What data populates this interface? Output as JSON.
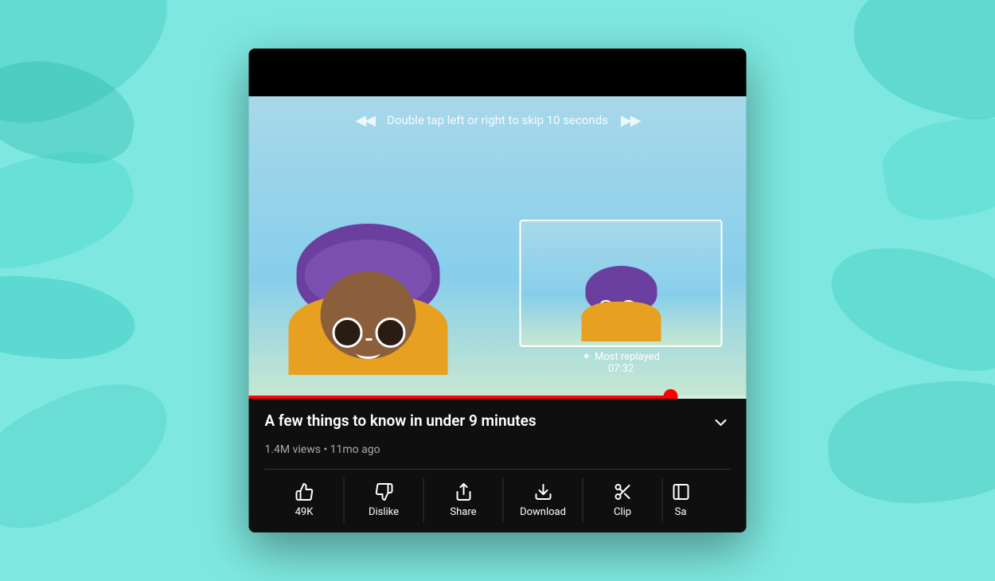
{
  "background": {
    "color": "#7ee8e0"
  },
  "device": {
    "top_bar_height": 60
  },
  "video": {
    "skip_hint": "Double tap left or right to skip 10 seconds",
    "most_replayed_label": "✦ Most replayed",
    "most_replayed_time": "07:32",
    "progress_percent": 85,
    "title": "A few things to know in under 9 minutes",
    "views": "1.4M views",
    "age": "11mo ago",
    "meta": "1.4M views • 11mo ago"
  },
  "actions": [
    {
      "id": "like",
      "label": "49K",
      "icon": "thumbs-up"
    },
    {
      "id": "dislike",
      "label": "Dislike",
      "icon": "thumbs-down"
    },
    {
      "id": "share",
      "label": "Share",
      "icon": "share"
    },
    {
      "id": "download",
      "label": "Download",
      "icon": "download"
    },
    {
      "id": "clip",
      "label": "Clip",
      "icon": "scissors"
    },
    {
      "id": "save",
      "label": "Sa...",
      "icon": "save"
    }
  ],
  "chevron": "∨"
}
